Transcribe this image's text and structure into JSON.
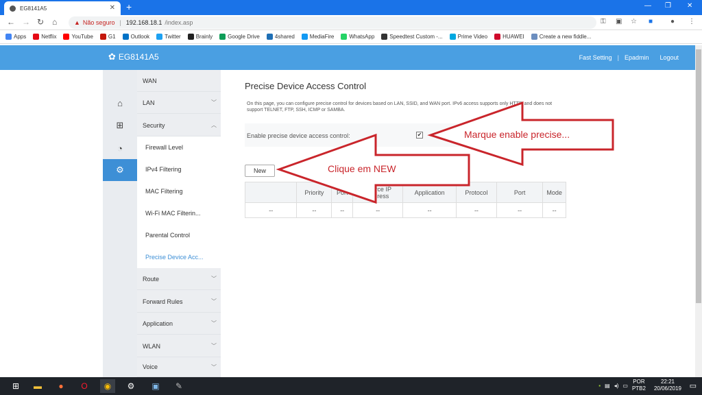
{
  "browser": {
    "tab_title": "EG8141A5",
    "new_tab": "+",
    "window_controls": [
      "—",
      "❐",
      "✕"
    ],
    "security_label": "Não seguro",
    "url_host": "192.168.18.1",
    "url_path": "/index.asp"
  },
  "bookmarks": [
    {
      "label": "Apps",
      "color": "#4285f4"
    },
    {
      "label": "Netflix",
      "color": "#e50914"
    },
    {
      "label": "YouTube",
      "color": "#ff0000"
    },
    {
      "label": "G1",
      "color": "#c4170c"
    },
    {
      "label": "Outlook",
      "color": "#0072c6"
    },
    {
      "label": "Twitter",
      "color": "#1da1f2"
    },
    {
      "label": "Brainly",
      "color": "#222222"
    },
    {
      "label": "Google Drive",
      "color": "#0f9d58"
    },
    {
      "label": "4shared",
      "color": "#1f6fb5"
    },
    {
      "label": "MediaFire",
      "color": "#1299f3"
    },
    {
      "label": "WhatsApp",
      "color": "#25d366"
    },
    {
      "label": "Speedtest Custom -...",
      "color": "#333333"
    },
    {
      "label": "Prime Video",
      "color": "#00a8e1"
    },
    {
      "label": "HUAWEI",
      "color": "#cf0a2c"
    },
    {
      "label": "Create a new fiddle...",
      "color": "#6c8ebf"
    }
  ],
  "router": {
    "model": "EG8141A5",
    "header_links": [
      "Fast Setting",
      "Epadmin",
      "Logout"
    ],
    "sidebar_icons": [
      "home-icon",
      "plus-box-icon",
      "pulse-icon",
      "gear-icon"
    ],
    "menu": {
      "wan": "WAN",
      "lan": "LAN",
      "security": "Security",
      "route": "Route",
      "forward_rules": "Forward Rules",
      "application": "Application",
      "wlan": "WLAN",
      "voice": "Voice"
    },
    "security_submenu": [
      "Firewall Level",
      "IPv4 Filtering",
      "MAC Filtering",
      "Wi-Fi MAC Filterin...",
      "Parental Control",
      "Precise Device Acc..."
    ]
  },
  "panel": {
    "title": "Precise Device Access Control",
    "description": "On this page, you can configure precise control for devices based on LAN, SSID, and WAN port. IPv6 access supports only HTTP, and does not support TELNET, FTP, SSH, ICMP or SAMBA.",
    "enable_label": "Enable precise device access control:",
    "enable_checked": "✔",
    "new_button": "New",
    "table": {
      "headers": [
        "",
        "Priority",
        "Port",
        "Source IP address",
        "Application",
        "Protocol",
        "Port",
        "Mode"
      ],
      "row": [
        "--",
        "--",
        "--",
        "--",
        "--",
        "--",
        "--",
        "--"
      ]
    }
  },
  "annotations": {
    "arrow1_text": "Marque enable precise...",
    "arrow2_text": "Clique em NEW",
    "arrow_color": "#c9252b"
  },
  "taskbar": {
    "lang_top": "POR",
    "lang_bottom": "PTB2",
    "time": "22:21",
    "date": "20/06/2019"
  }
}
